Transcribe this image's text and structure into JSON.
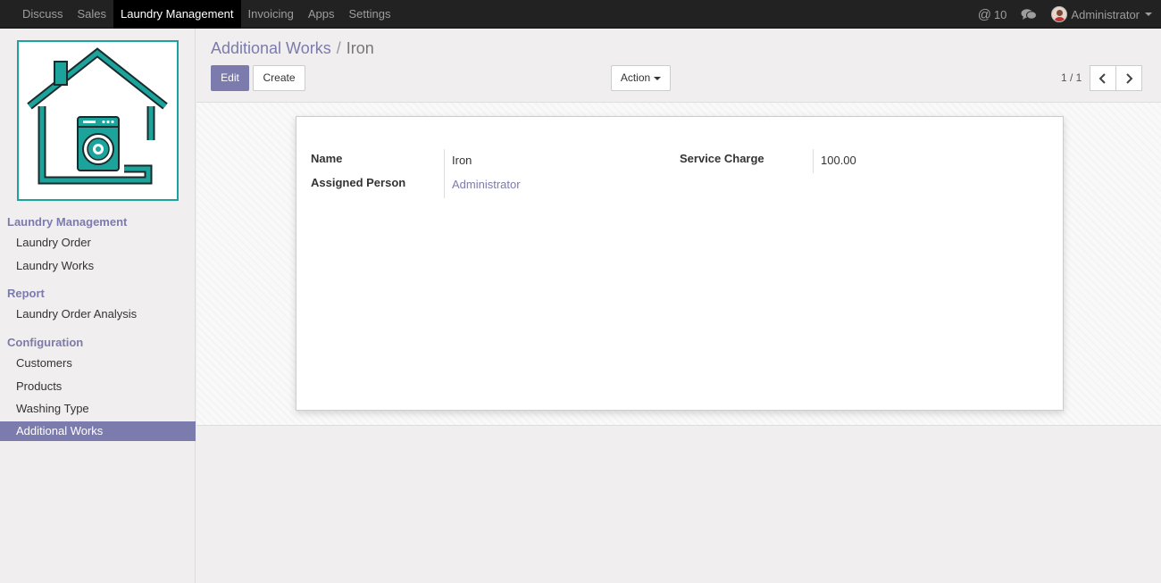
{
  "topbar": {
    "menu": [
      "Discuss",
      "Sales",
      "Laundry Management",
      "Invoicing",
      "Apps",
      "Settings"
    ],
    "active_index": 2,
    "messages_count": "10",
    "user": "Administrator"
  },
  "sidebar": {
    "sections": [
      {
        "title": "Laundry Management",
        "items": [
          "Laundry Order",
          "Laundry Works"
        ]
      },
      {
        "title": "Report",
        "items": [
          "Laundry Order Analysis"
        ]
      },
      {
        "title": "Configuration",
        "items": [
          "Customers",
          "Products",
          "Washing Type",
          "Additional Works"
        ]
      }
    ],
    "active_item": "Additional Works"
  },
  "breadcrumb": {
    "parent": "Additional Works",
    "separator": "/",
    "current": "Iron"
  },
  "buttons": {
    "edit": "Edit",
    "create": "Create",
    "action": "Action"
  },
  "pager": {
    "value": "1 / 1"
  },
  "form": {
    "name_label": "Name",
    "name_value": "Iron",
    "assigned_label": "Assigned Person",
    "assigned_value": "Administrator",
    "service_charge_label": "Service Charge",
    "service_charge_value": "100.00"
  },
  "colors": {
    "accent": "#7c7bad",
    "navbar": "#222222",
    "logo_teal": "#1ba39c"
  },
  "icons": [
    "at-icon",
    "chat-icon",
    "avatar",
    "chevron-left-icon",
    "chevron-right-icon",
    "laundry-house-logo"
  ]
}
